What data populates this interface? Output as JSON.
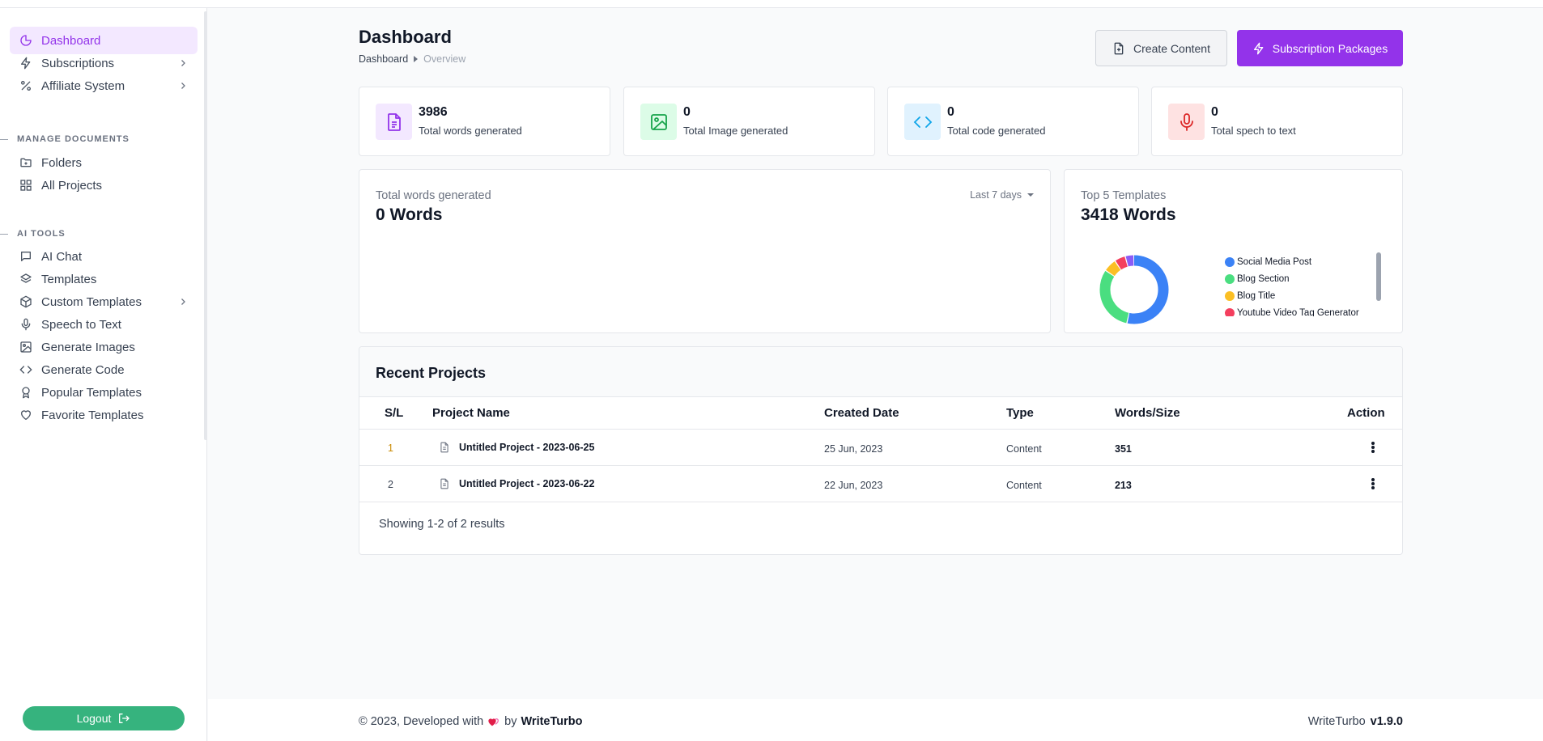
{
  "sidebar": {
    "items": [
      {
        "label": "Dashboard",
        "icon": "pie-chart-icon",
        "active": true
      },
      {
        "label": "Subscriptions",
        "icon": "bolt-icon"
      },
      {
        "label": "Affiliate System",
        "icon": "percent-icon"
      }
    ],
    "manage_documents": {
      "label": "MANAGE DOCUMENTS",
      "items": [
        {
          "label": "Folders",
          "icon": "folder-plus-icon"
        },
        {
          "label": "All Projects",
          "icon": "grid-icon"
        }
      ]
    },
    "ai_tools": {
      "label": "AI TOOLS",
      "items": [
        {
          "label": "AI Chat",
          "icon": "chat-icon"
        },
        {
          "label": "Templates",
          "icon": "layers-icon"
        },
        {
          "label": "Custom Templates",
          "icon": "cube-icon"
        },
        {
          "label": "Speech to Text",
          "icon": "microphone-icon"
        },
        {
          "label": "Generate Images",
          "icon": "image-icon"
        },
        {
          "label": "Generate Code",
          "icon": "code-icon"
        },
        {
          "label": "Popular Templates",
          "icon": "award-icon"
        },
        {
          "label": "Favorite Templates",
          "icon": "heart-icon"
        }
      ]
    },
    "logout_label": "Logout"
  },
  "header": {
    "title": "Dashboard",
    "breadcrumb": [
      "Dashboard",
      "Overview"
    ],
    "create_content_label": "Create Content",
    "subscription_packages_label": "Subscription Packages"
  },
  "stats": [
    {
      "value": "3986",
      "label": "Total words generated",
      "icon": "document-icon",
      "color": "#9333ea",
      "bg": "#f3e8ff"
    },
    {
      "value": "0",
      "label": "Total Image generated",
      "icon": "image-icon",
      "color": "#16a34a",
      "bg": "#dcfce7"
    },
    {
      "value": "0",
      "label": "Total code generated",
      "icon": "code-icon",
      "color": "#0ea5e9",
      "bg": "#e0f2fe"
    },
    {
      "value": "0",
      "label": "Total spech to text",
      "icon": "microphone-icon",
      "color": "#dc2626",
      "bg": "#fee2e2"
    }
  ],
  "words_card": {
    "title": "Total words generated",
    "value": "0 Words",
    "range": "Last 7 days"
  },
  "templates_card": {
    "title": "Top 5 Templates",
    "value": "3418 Words"
  },
  "chart_data": {
    "type": "pie",
    "title": "Top 5 Templates",
    "donut": true,
    "categories": [
      "Social Media Post",
      "Blog Section",
      "Blog Title",
      "Youtube Video Tag Generator",
      ""
    ],
    "values": [
      52,
      30,
      6,
      5,
      4
    ],
    "colors": [
      "#3b82f6",
      "#4ade80",
      "#fbbf24",
      "#f43f5e",
      "#8b5cf6"
    ],
    "legend": "right"
  },
  "recent": {
    "title": "Recent Projects",
    "columns": [
      "S/L",
      "Project Name",
      "Created Date",
      "Type",
      "Words/Size",
      "Action"
    ],
    "rows": [
      {
        "sl": "1",
        "name": "Untitled Project - 2023-06-25",
        "date": "25 Jun, 2023",
        "type": "Content",
        "words": "351"
      },
      {
        "sl": "2",
        "name": "Untitled Project - 2023-06-22",
        "date": "22 Jun, 2023",
        "type": "Content",
        "words": "213"
      }
    ],
    "showing": "Showing 1-2 of 2 results",
    "sl_colors": [
      "#ca8a04",
      "#374151"
    ]
  },
  "footer": {
    "left_text": "© 2023, Developed with",
    "by_text": "by",
    "brand": "WriteTurbo",
    "right_name": "WriteTurbo",
    "version": "v1.9.0"
  }
}
